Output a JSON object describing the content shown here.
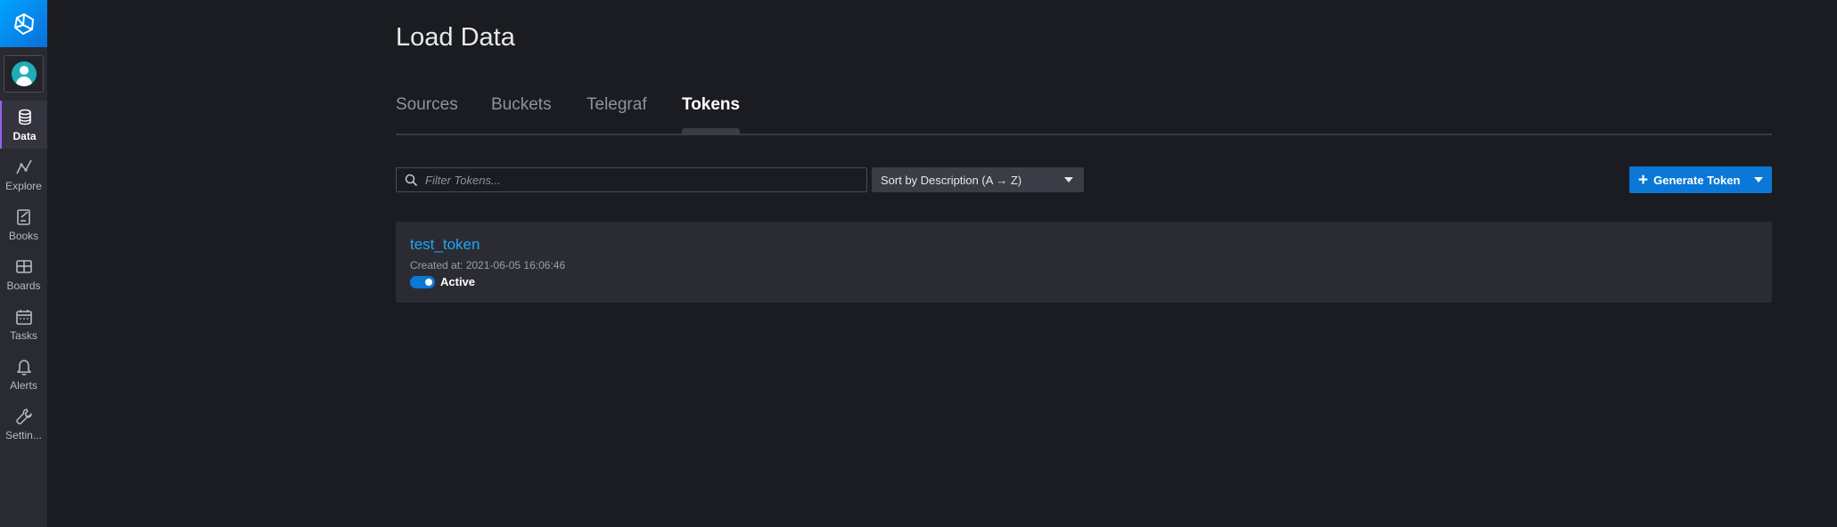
{
  "sidebar": {
    "items": [
      {
        "label": "Data",
        "icon": "database-icon",
        "active": true
      },
      {
        "label": "Explore",
        "icon": "graph-icon",
        "active": false
      },
      {
        "label": "Books",
        "icon": "notebook-icon",
        "active": false
      },
      {
        "label": "Boards",
        "icon": "dashboard-icon",
        "active": false
      },
      {
        "label": "Tasks",
        "icon": "calendar-icon",
        "active": false
      },
      {
        "label": "Alerts",
        "icon": "bell-icon",
        "active": false
      },
      {
        "label": "Settin...",
        "icon": "wrench-icon",
        "active": false
      }
    ]
  },
  "header": {
    "title": "Load Data"
  },
  "tabs": [
    {
      "label": "Sources",
      "active": false
    },
    {
      "label": "Buckets",
      "active": false
    },
    {
      "label": "Telegraf",
      "active": false
    },
    {
      "label": "Tokens",
      "active": true
    }
  ],
  "toolbar": {
    "search_placeholder": "Filter Tokens...",
    "sort_label": "Sort by Description (A → Z)",
    "generate_label": "Generate Token"
  },
  "tokens": [
    {
      "name": "test_token",
      "created": "Created at: 2021-06-05 16:06:46",
      "status": "Active"
    }
  ],
  "colors": {
    "accent": "#0b78d8",
    "link": "#22a4f5",
    "active_nav_border": "#9b5ef3"
  }
}
